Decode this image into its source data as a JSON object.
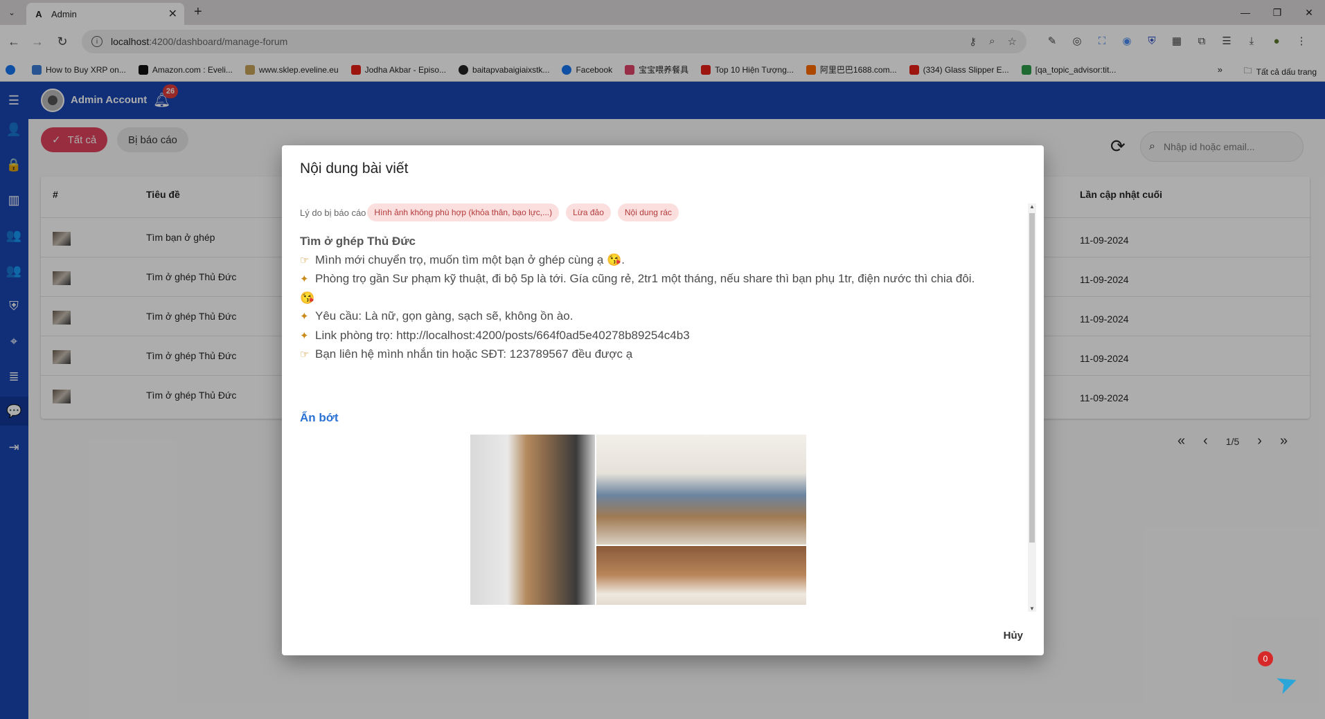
{
  "browser": {
    "tab_title": "Admin",
    "url_host": "localhost",
    "url_rest": ":4200/dashboard/manage-forum",
    "bookmarks": [
      {
        "label": "How to Buy XRP on...",
        "color": "#3b7dd8"
      },
      {
        "label": "Amazon.com : Eveli...",
        "color": "#111111"
      },
      {
        "label": "www.sklep.eveline.eu",
        "color": "#c8a25a"
      },
      {
        "label": "Jodha Akbar - Episo...",
        "color": "#e62117"
      },
      {
        "label": "baitapvabaigiaixstk...",
        "color": "#222222"
      },
      {
        "label": "Facebook",
        "color": "#1877f2"
      },
      {
        "label": "宝宝喂养餐具",
        "color": "#e0436b"
      },
      {
        "label": "Top 10 Hiện Tượng...",
        "color": "#e62117"
      },
      {
        "label": "阿里巴巴1688.com...",
        "color": "#ff6a00"
      },
      {
        "label": "(334) Glass Slipper E...",
        "color": "#e62117"
      },
      {
        "label": "[qa_topic_advisor:tit...",
        "color": "#2e9c4a"
      }
    ],
    "bookmarks_more": "»",
    "bookmarks_folder": "Tất cả dấu trang"
  },
  "app": {
    "account_name": "Admin Account",
    "notification_count": "26",
    "filters": {
      "all": "Tất cả",
      "reported": "Bị báo cáo"
    },
    "search_placeholder": "Nhập id hoặc email...",
    "table": {
      "headers": {
        "index": "#",
        "title": "Tiêu đề",
        "updated": "Lần cập nhật cuối"
      },
      "rows": [
        {
          "title": "Tìm bạn ở ghép",
          "date": "11-09-2024"
        },
        {
          "title": "Tìm ở ghép Thủ Đức",
          "date": "11-09-2024"
        },
        {
          "title": "Tìm ở ghép Thủ Đức",
          "date": "11-09-2024"
        },
        {
          "title": "Tìm ở ghép Thủ Đức",
          "date": "11-09-2024"
        },
        {
          "title": "Tìm ở ghép Thủ Đức",
          "date": "11-09-2024"
        }
      ]
    },
    "pagination": {
      "first": "«",
      "prev": "‹",
      "page": "1/5",
      "next": "›",
      "last": "»"
    },
    "chat_badge": "0"
  },
  "dialog": {
    "title": "Nội dung bài viết",
    "reason_label": "Lý do bị báo cáo",
    "reasons": [
      "Hình ảnh không phù hợp (khỏa thân, bạo lực,...)",
      "Lừa đảo",
      "Nội dung rác"
    ],
    "post_title": "Tìm ở ghép Thủ Đức",
    "post_lines": [
      "Mình mới chuyển trọ, muốn tìm một bạn ở ghép cùng ạ 😘.",
      "Phòng trọ gần Sư phạm kỹ thuật, đi bộ 5p là tới. Gía cũng rẻ, 2tr1 một tháng, nếu share thì bạn phụ 1tr, điện nước thì chia đôi. 😘",
      "Yêu cầu: Là nữ, gọn gàng, sạch sẽ, không ồn ào.",
      "Link phòng trọ: http://localhost:4200/posts/664f0ad5e40278b89254c4b3",
      "Bạn liên hệ mình nhắn tin hoặc SĐT: 123789567 đều được ạ"
    ],
    "hide_label": "Ẩn bớt",
    "cancel_label": "Hủy"
  }
}
